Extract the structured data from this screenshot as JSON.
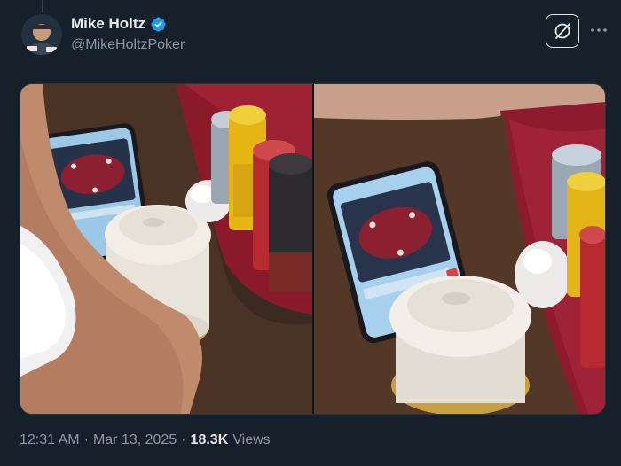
{
  "author": {
    "display_name": "Mike Holtz",
    "handle": "@MikeHoltzPoker",
    "verified": true,
    "avatar_icon": "avatar-photo"
  },
  "actions": {
    "grok_icon": "grok-icon",
    "more_icon": "more-dots-icon"
  },
  "media": {
    "count": 2
  },
  "meta": {
    "time": "12:31 AM",
    "separator": "·",
    "date": "Mar 13, 2025",
    "views_count": "18.3K",
    "views_label": "Views"
  },
  "colors": {
    "background": "#15202b",
    "secondary_text": "#8b98a5",
    "verified_blue": "#1d9bf0"
  }
}
